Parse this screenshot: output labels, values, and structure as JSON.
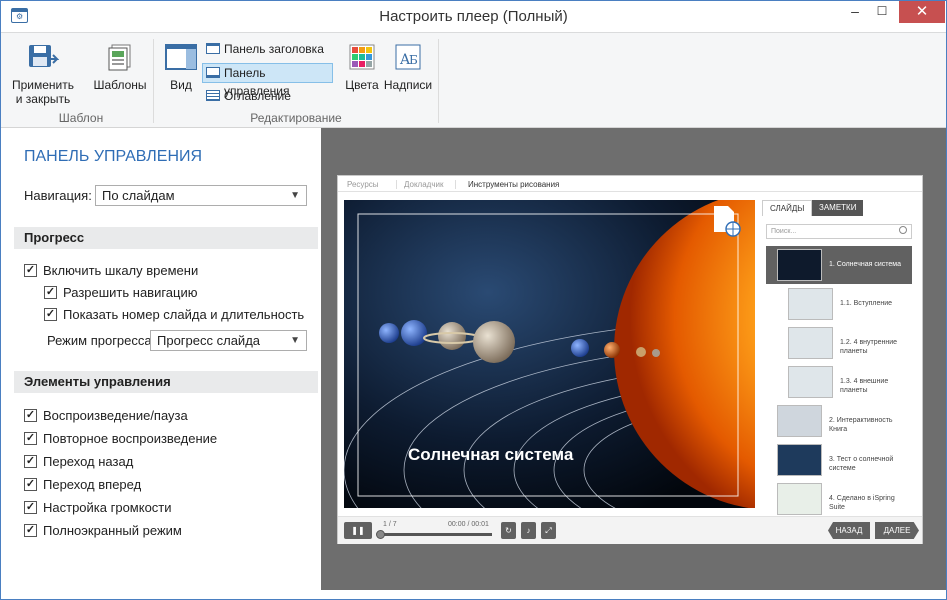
{
  "window": {
    "title": "Настроить плеер (Полный)",
    "minimize": "‒",
    "maximize": "☐",
    "close": "✕"
  },
  "ribbon": {
    "apply_close": "Применить\nи закрыть",
    "apply_close_1": "Применить",
    "apply_close_2": "и закрыть",
    "templates": "Шаблоны",
    "group_template": "Шаблон",
    "view": "Вид",
    "title_panel": "Панель заголовка",
    "control_panel": "Панель управления",
    "toc": "Оглавление",
    "colors": "Цвета",
    "labels": "Надписи",
    "group_edit": "Редактирование"
  },
  "settings": {
    "heading": "ПАНЕЛЬ УПРАВЛЕНИЯ",
    "navigation_label": "Навигация:",
    "navigation_value": "По слайдам",
    "progress_section": "Прогресс",
    "enable_timeline": "Включить шкалу времени",
    "allow_navigation": "Разрешить навигацию",
    "show_slide_number": "Показать номер слайда и длительность",
    "progress_mode_label": "Режим прогресса:",
    "progress_mode_value": "Прогресс слайда",
    "controls_section": "Элементы управления",
    "controls": [
      "Воспроизведение/пауза",
      "Повторное воспроизведение",
      "Переход назад",
      "Переход вперед",
      "Настройка громкости",
      "Полноэкранный режим"
    ],
    "check_mark": "✓"
  },
  "preview": {
    "tabs": [
      "Ресурсы",
      "Докладчик",
      "Инструменты рисования"
    ],
    "slide_title": "Солнечная система",
    "side_tabs": [
      "СЛАЙДЫ",
      "ЗАМЕТКИ"
    ],
    "search_placeholder": "Поиск...",
    "slides": [
      "1. Солнечная система",
      "1.1. Вступление",
      "1.2. 4 внутренние планеты",
      "1.3. 4 внешние планеты",
      "2. Интерактивность Книга",
      "3. Тест о солнечной системе",
      "4. Сделано в iSpring Suite"
    ],
    "slide_counter": "1 / 7",
    "time": "00:00 / 00:01",
    "back": "НАЗАД",
    "next": "ДАЛЕЕ"
  },
  "colors": {
    "accent": "#2f6db5",
    "close_button": "#c75050",
    "preview_background": "#6e6e6e",
    "player_controls": "#616161"
  }
}
